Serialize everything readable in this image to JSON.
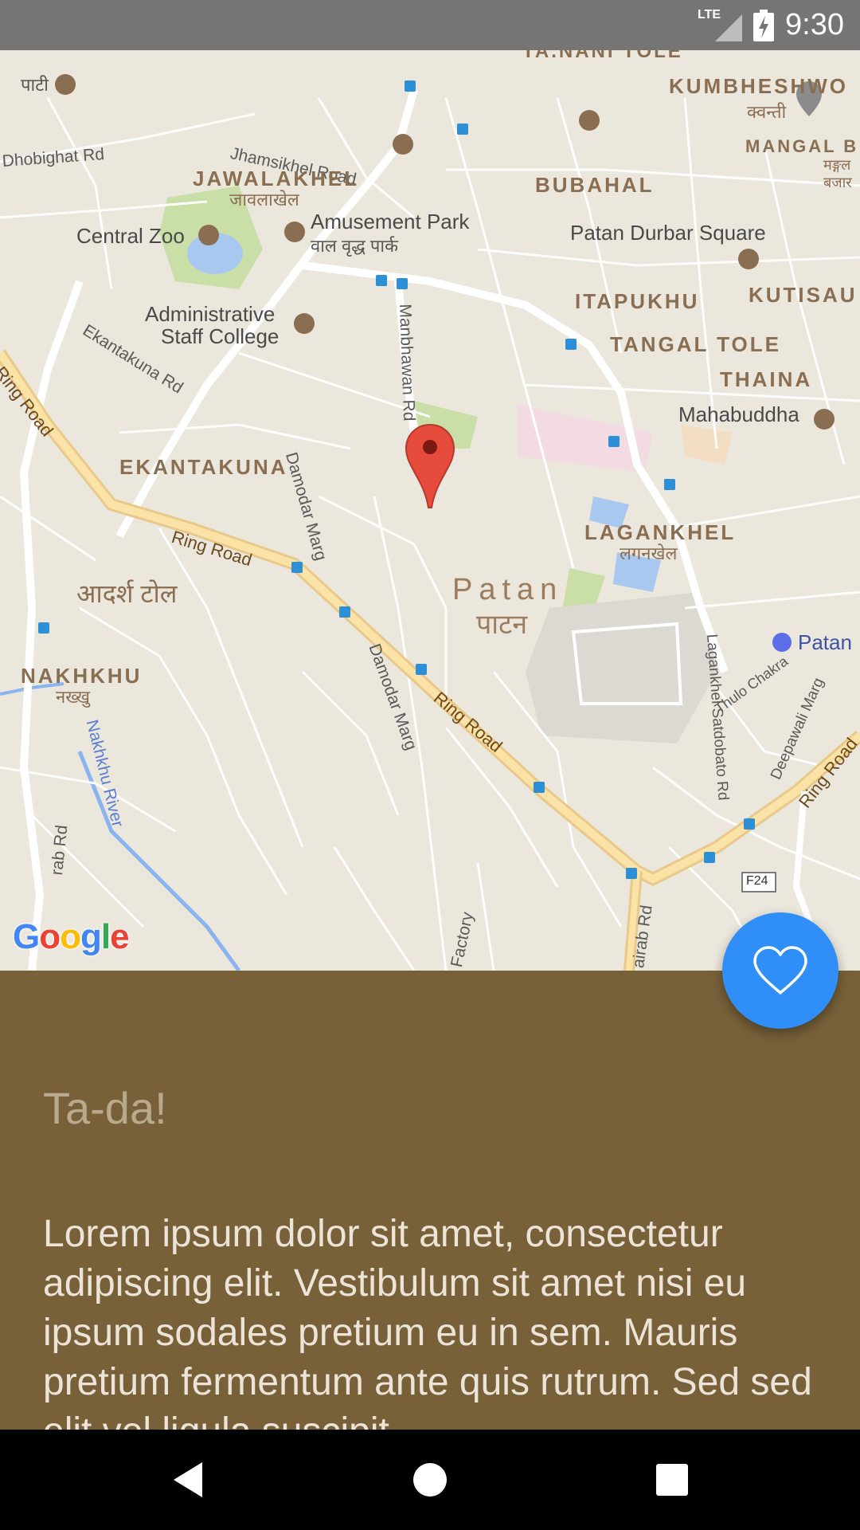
{
  "status_bar": {
    "network": "LTE",
    "time": "9:30"
  },
  "map": {
    "labels": {
      "pati": "पाटी",
      "jhamsikhel": "Jhamsikhel Road",
      "dhobighat": "Dhobighat Rd",
      "jawalakhel": "JAWALAKHEL",
      "jawalakhel_dev": "जावलाखेल",
      "central_zoo": "Central Zoo",
      "amusement_park": "Amusement Park",
      "amusement_park_dev": "वाल वृद्ध पार्क",
      "admin_college_1": "Administrative",
      "admin_college_2": "Staff College",
      "ekantakuna_rd": "Ekantakuna Rd",
      "ring_road": "Ring Road",
      "ekantakuna": "EKANTAKUNA",
      "damodar_marg": "Damodar Marg",
      "manbhawan": "Manbhawan Rd",
      "adarsh_tol": "आदर्श टोल",
      "nakhkhu": "NAKHKHU",
      "nakhkhu_dev": "नख्खु",
      "nakhkhu_river": "Nakhkhu River",
      "patan": "Patan",
      "patan_dev": "पाटन",
      "lagankhel": "LAGANKHEL",
      "lagankhel_dev": "लगनखेल",
      "patan_right": "Patan",
      "lagankhel_satdobato": "Lagankhel Satdobato Rd",
      "thulo_chakra": "Thulo Chakra",
      "deepawali": "Deepawali Marg",
      "f24": "F24",
      "bubahal": "BUBAHAL",
      "patan_durbar": "Patan Durbar Square",
      "itapukhu": "ITAPUKHU",
      "tangal_tole": "TANGAL TOLE",
      "thaina": "THAINA",
      "mahabuddha": "Mahabuddha",
      "kumbheshwor": "KUMBHESHWO",
      "kumbheshwor_dev": "क्वन्ती",
      "mangal": "MANGAL B",
      "mangal_dev_1": "मङ्गल",
      "mangal_dev_2": "बजार",
      "kutisau": "KUTISAU",
      "tanani": "TA.NANI TOLE",
      "rab_rd": "rab Rd",
      "factory": "Factory",
      "bhairab_rd": "airab Rd"
    }
  },
  "attribution": {
    "logo_letters": [
      "G",
      "o",
      "o",
      "g",
      "l",
      "e"
    ],
    "logo_colors": [
      "#4285F4",
      "#EA4335",
      "#FBBC05",
      "#4285F4",
      "#34A853",
      "#EA4335"
    ]
  },
  "fab": {
    "icon": "heart-outline-icon",
    "color": "#2f8ef7"
  },
  "panel": {
    "title": "Ta-da!",
    "body": "Lorem ipsum dolor sit amet, consectetur adipiscing elit. Vestibulum sit amet nisi eu ipsum sodales pretium eu in sem. Mauris pretium fermentum ante quis rutrum. Sed sed elit vel ligula suscipit",
    "background": "#786139"
  },
  "nav_bar": {
    "back_icon": "back-triangle-icon",
    "home_icon": "home-circle-icon",
    "recents_icon": "recents-square-icon"
  }
}
